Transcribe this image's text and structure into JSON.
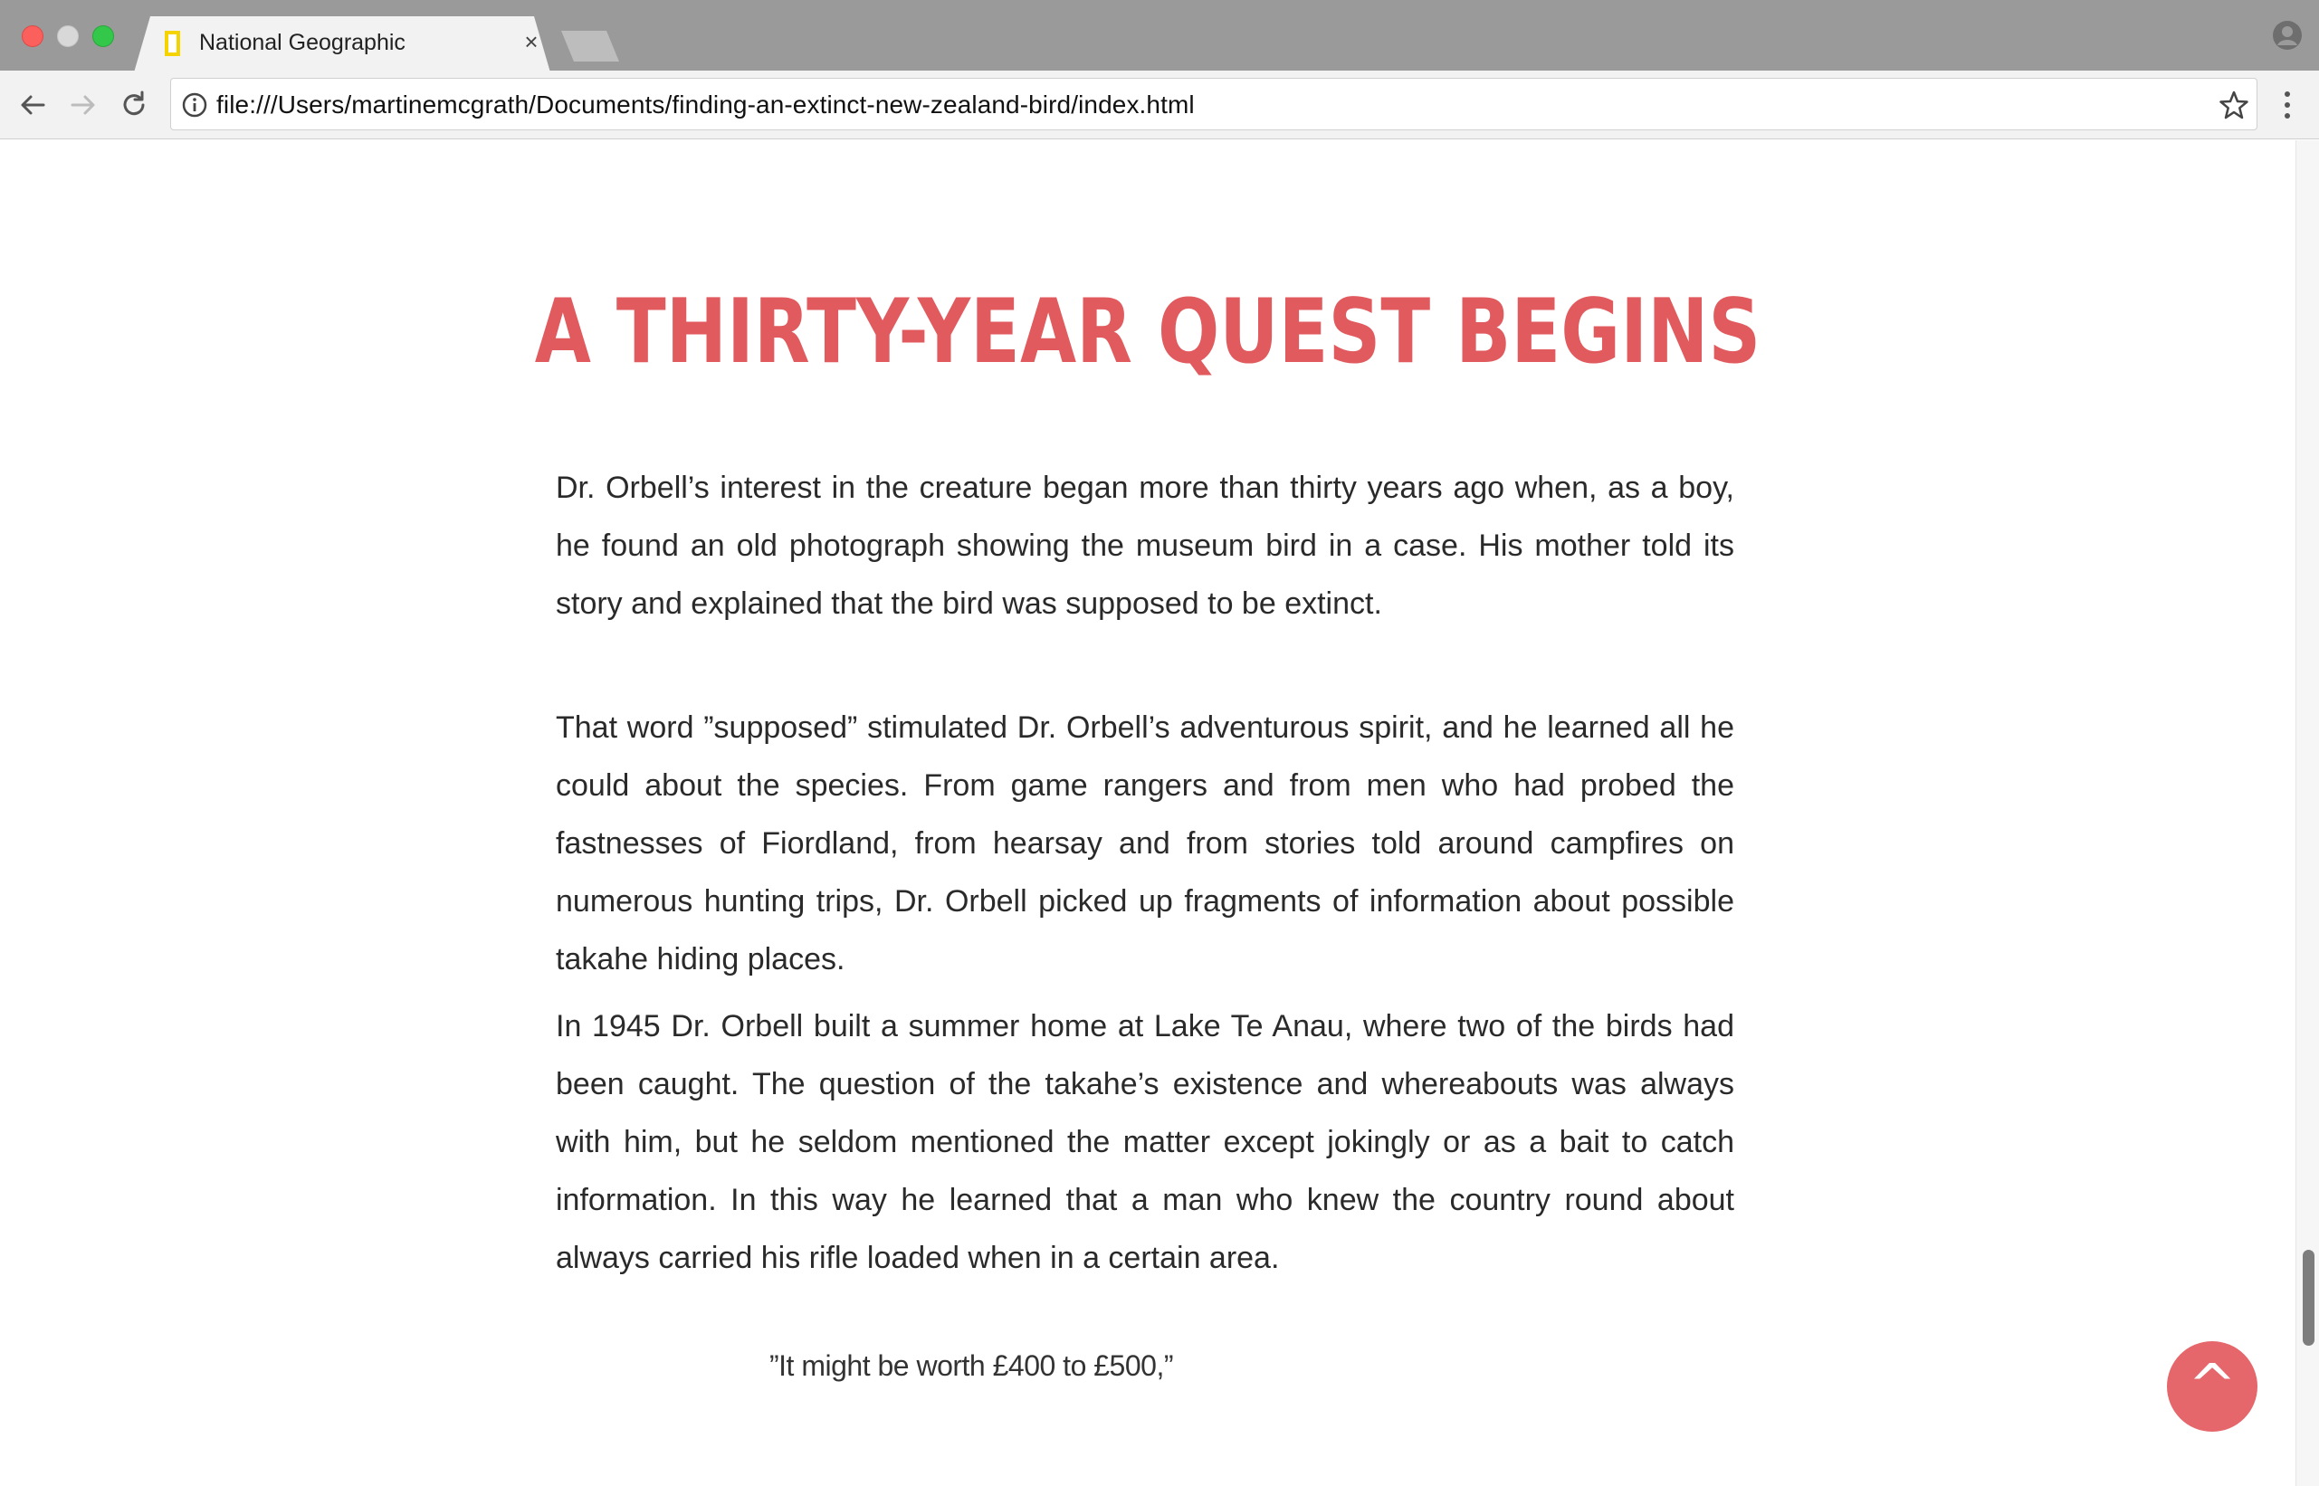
{
  "browser": {
    "tab_title": "National Geographic",
    "tab_close_glyph": "×",
    "url": "file:///Users/martinemcgrath/Documents/finding-an-extinct-new-zealand-bird/index.html",
    "icons": {
      "back": "arrow-left-icon",
      "forward": "arrow-right-icon",
      "reload": "reload-icon",
      "info": "info-icon",
      "bookmark": "star-icon",
      "menu": "kebab-menu-icon",
      "profile": "profile-icon",
      "favicon": "natgeo-favicon"
    },
    "colors": {
      "titlebar": "#9a9a9a",
      "tab": "#f2f2f2",
      "favicon_yellow": "#f5d300"
    }
  },
  "article": {
    "heading": "A THIRTY-YEAR QUEST BEGINS",
    "paragraphs": [
      "Dr. Orbell’s interest in the creature began more than thirty years ago when, as a boy, he found an old photograph showing the museum bird in a case. His mother told its story and explained that the bird was supposed to be extinct.",
      "That word ”supposed” stimulated Dr. Orbell’s adventurous spirit, and he learned all he could about the species. From game rangers and from men who had probed the fastnesses of Fiordland, from hearsay and from stories told around campfires on numerous hunting trips, Dr. Orbell picked up fragments of information about possible takahe hiding places.",
      "In 1945 Dr. Orbell built a summer home at Lake Te Anau, where two of the birds had been caught. The question of the takahe’s existence and whereabouts was always with him, but he seldom mentioned the matter except jokingly or as a bait to catch information. In this way he learned that a man who knew the country round about always carried his rifle loaded when in a certain area."
    ],
    "quote": "”It might be worth £400 to £500,”",
    "colors": {
      "heading": "#e05a5e",
      "body_text": "#2a2a2a"
    }
  },
  "back_to_top": {
    "glyph": "^",
    "color": "#e5676b"
  }
}
